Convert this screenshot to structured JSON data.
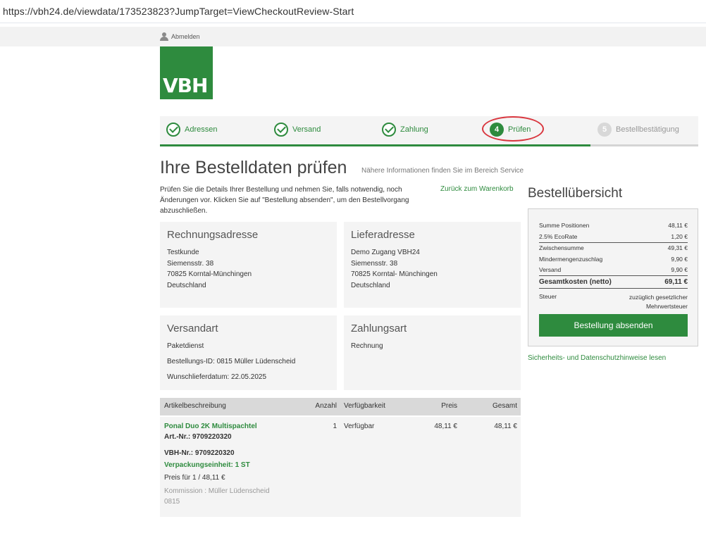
{
  "browser": {
    "url": "https://vbh24.de/viewdata/173523823?JumpTarget=ViewCheckoutReview-Start"
  },
  "header": {
    "logout_label": "Abmelden",
    "logo_text": "VBH"
  },
  "steps": [
    {
      "label": "Adressen",
      "state": "done"
    },
    {
      "label": "Versand",
      "state": "done"
    },
    {
      "label": "Zahlung",
      "state": "done"
    },
    {
      "number": "4",
      "label": "Prüfen",
      "state": "active"
    },
    {
      "number": "5",
      "label": "Bestellbestätigung",
      "state": "todo"
    }
  ],
  "main": {
    "title": "Ihre Bestelldaten prüfen",
    "hint": "Nähere Informationen finden Sie im Bereich Service",
    "intro": "Prüfen Sie die Details Ihrer Bestellung und nehmen Sie, falls notwendig, noch Änderungen vor. Klicken Sie auf \"Bestellung absenden\", um den Bestellvorgang abzuschließen.",
    "back_link": "Zurück zum Warenkorb"
  },
  "billing": {
    "title": "Rechnungsadresse",
    "lines": [
      "Testkunde",
      "Siemensstr. 38",
      "70825  Korntal-Münchingen",
      "Deutschland"
    ]
  },
  "delivery": {
    "title": "Lieferadresse",
    "lines": [
      "Demo Zugang VBH24",
      "Siemensstr. 38",
      "70825  Korntal- Münchingen",
      "Deutschland"
    ]
  },
  "shipping": {
    "title": "Versandart",
    "method": "Paketdienst",
    "order_id": "Bestellungs-ID:  0815 Müller Lüdenscheid",
    "date": "Wunschlieferdatum:  22.05.2025"
  },
  "payment": {
    "title": "Zahlungsart",
    "method": "Rechnung"
  },
  "summary": {
    "title": "Bestellübersicht",
    "rows": [
      {
        "label": "Summe Positionen",
        "value": "48,11 €"
      },
      {
        "label": "2.5% EcoRate",
        "value": "1,20 €"
      },
      {
        "label": "Zwischensumme",
        "value": "49,31 €"
      },
      {
        "label": "Mindermengenzuschlag",
        "value": "9,90 €"
      },
      {
        "label": "Versand",
        "value": "9,90 €"
      },
      {
        "label": "Gesamtkosten (netto)",
        "value": "69,11 €"
      }
    ],
    "tax_label": "Steuer",
    "tax_value_1": "zuzüglich gesetzlicher",
    "tax_value_2": "Mehrwertsteuer",
    "submit_label": "Bestellung absenden",
    "privacy_link": "Sicherheits- und Datenschutzhinweise lesen"
  },
  "table": {
    "headers": [
      "Artikelbeschreibung",
      "Anzahl",
      "Verfügbarkeit",
      "Preis",
      "Gesamt"
    ],
    "item": {
      "name": "Ponal Duo 2K Multispachtel",
      "art_nr": "Art.-Nr.: 9709220320",
      "vbh_nr": "VBH-Nr.: 9709220320",
      "packaging": "Verpackungseinheit: 1 ST",
      "unit_price": "Preis für 1 / 48,11 €",
      "commission_1": "Kommission : Müller Lüdenscheid",
      "commission_2": "0815",
      "qty": "1",
      "availability": "Verfügbar",
      "price": "48,11 €",
      "total": "48,11 €"
    }
  },
  "colors": {
    "brand_green": "#2e8b3e",
    "highlight_red": "#d9363e",
    "panel_gray": "#f4f4f4"
  }
}
